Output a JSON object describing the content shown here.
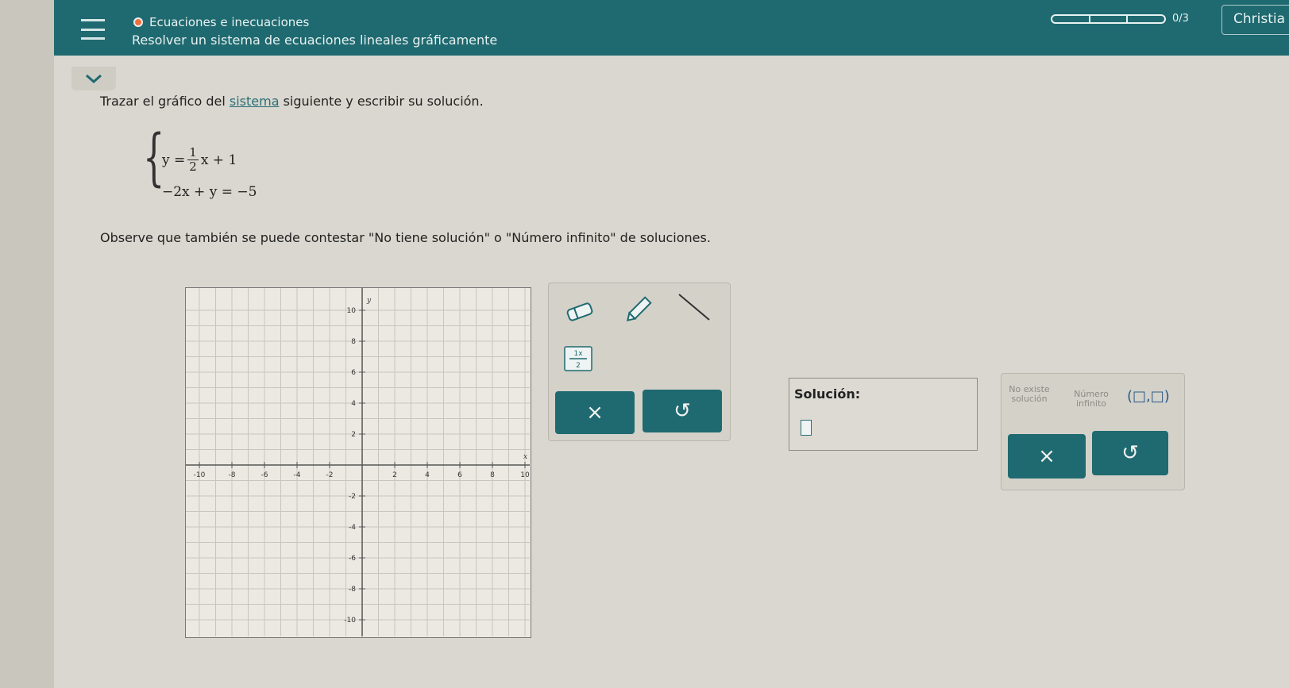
{
  "header": {
    "topic": "Ecuaciones e inecuaciones",
    "title": "Resolver un sistema de ecuaciones lineales gráficamente",
    "progress_text": "0/3",
    "user": "Christia"
  },
  "question": {
    "prompt_before": "Trazar el gráfico del ",
    "prompt_link": "sistema",
    "prompt_after": " siguiente y escribir su solución.",
    "eq1_left": "y =",
    "eq1_num": "1",
    "eq1_den": "2",
    "eq1_right": "x + 1",
    "eq2": "−2x + y = −5",
    "note": "Observe que también se puede contestar \"No tiene solución\" o \"Número infinito\" de soluciones."
  },
  "graph": {
    "x_label": "x",
    "y_label": "y",
    "x_ticks": [
      "-10",
      "-8",
      "-6",
      "-4",
      "-2",
      "2",
      "4",
      "6",
      "8",
      "10"
    ],
    "y_ticks": [
      "10",
      "8",
      "6",
      "4",
      "2",
      "-2",
      "-4",
      "-6",
      "-8",
      "-10"
    ]
  },
  "tools": {
    "clear_label": "×",
    "undo_label": "↺"
  },
  "answer": {
    "label": "Solución:",
    "no_solution": "No existe solución",
    "infinite": "Número infinito",
    "pair": "(□,□)",
    "clear_label": "×",
    "undo_label": "↺"
  }
}
